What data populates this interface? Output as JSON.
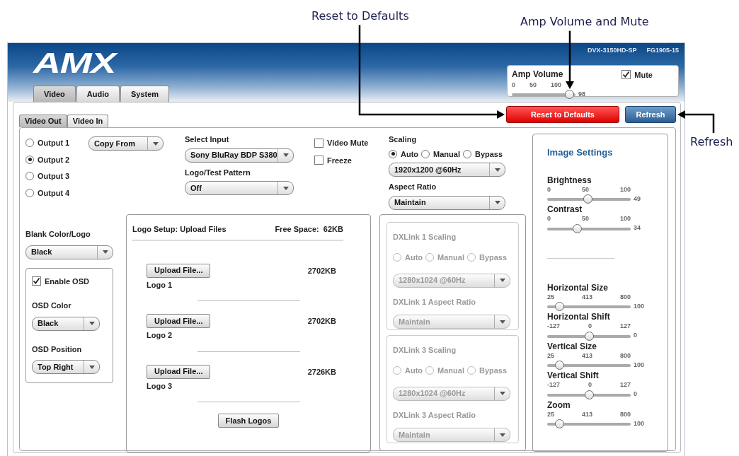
{
  "header": {
    "logo": "AMX",
    "model": "DVX-3150HD-SP",
    "serial": "FG1905-15"
  },
  "main_tabs": [
    {
      "label": "Video",
      "selected": true
    },
    {
      "label": "Audio",
      "selected": false
    },
    {
      "label": "System",
      "selected": false
    }
  ],
  "amp": {
    "title": "Amp Volume",
    "ticks": [
      "0",
      "50",
      "100"
    ],
    "level": 0.98,
    "reading": "98",
    "mute": {
      "label": "Mute",
      "checked": true
    },
    "callout": "Amp Volume and Mute"
  },
  "sub_tabs": [
    {
      "label": "Video Out",
      "selected": true
    },
    {
      "label": "Video In",
      "selected": false
    }
  ],
  "actions": [
    {
      "label": "Reset to Defaults",
      "kind": "danger",
      "callout": "Reset to Defaults"
    },
    {
      "label": "Refresh",
      "kind": "primary",
      "callout": "Refresh"
    }
  ],
  "outputs": [
    {
      "label": "Output 1",
      "selected": false
    },
    {
      "label": "Output 2",
      "selected": true
    },
    {
      "label": "Output 3",
      "selected": false
    },
    {
      "label": "Output 4",
      "selected": false
    }
  ],
  "copy_from": {
    "value": "Copy From"
  },
  "select_input": {
    "label": "Select Input",
    "value": "Sony BluRay BDP S380"
  },
  "logo_pattern": {
    "label": "Logo/Test Pattern",
    "value": "Off"
  },
  "toggles": [
    {
      "label": "Video Mute",
      "checked": false
    },
    {
      "label": "Freeze",
      "checked": false
    }
  ],
  "scaling": {
    "label": "Scaling",
    "modes": [
      {
        "label": "Auto",
        "selected": true
      },
      {
        "label": "Manual",
        "selected": false
      },
      {
        "label": "Bypass",
        "selected": false
      }
    ],
    "resolution": "1920x1200 @60Hz",
    "aspect_label": "Aspect Ratio",
    "aspect": "Maintain"
  },
  "dxlink": [
    {
      "title": "DXLink 1 Scaling",
      "disabled": true,
      "modes": [
        {
          "label": "Auto",
          "selected": false
        },
        {
          "label": "Manual",
          "selected": false
        },
        {
          "label": "Bypass",
          "selected": false
        }
      ],
      "resolution": "1280x1024 @60Hz",
      "aspect_label": "DXLink 1 Aspect Ratio",
      "aspect": "Maintain"
    },
    {
      "title": "DXLink 3 Scaling",
      "disabled": true,
      "modes": [
        {
          "label": "Auto",
          "selected": false
        },
        {
          "label": "Manual",
          "selected": false
        },
        {
          "label": "Bypass",
          "selected": false
        }
      ],
      "resolution": "1280x1024 @60Hz",
      "aspect_label": "DXLink 3 Aspect Ratio",
      "aspect": "Maintain"
    }
  ],
  "blank": {
    "label": "Blank Color/Logo",
    "value": "Black"
  },
  "osd": {
    "enable": {
      "label": "Enable OSD",
      "checked": true
    },
    "color_label": "OSD Color",
    "color_choice": "Black",
    "position_label": "OSD Position",
    "position": "Top Right"
  },
  "logo_setup": {
    "title": "Logo Setup: Upload Files",
    "free_space": "Free Space:  62KB",
    "logos": [
      {
        "button": "Upload File...",
        "name": "Logo 1",
        "size": "2702KB"
      },
      {
        "button": "Upload File...",
        "name": "Logo 2",
        "size": "2702KB"
      },
      {
        "button": "Upload File...",
        "name": "Logo 3",
        "size": "2726KB"
      }
    ],
    "flash": "Flash Logos"
  },
  "image_settings": {
    "title": "Image Settings",
    "sliders": [
      {
        "label": "Brightness",
        "ticks": [
          "0",
          "50",
          "100"
        ],
        "level": 0.49,
        "reading": "49"
      },
      {
        "label": "Contrast",
        "ticks": [
          "0",
          "50",
          "100"
        ],
        "level": 0.34,
        "reading": "34"
      },
      {
        "label": "Horizontal Size",
        "ticks": [
          "25",
          "413",
          "800"
        ],
        "level": 0.1,
        "reading": "100",
        "divider_before": true
      },
      {
        "label": "Horizontal Shift",
        "ticks": [
          "-127",
          "0",
          "127"
        ],
        "level": 0.5,
        "reading": "0"
      },
      {
        "label": "Vertical Size",
        "ticks": [
          "25",
          "413",
          "800"
        ],
        "level": 0.1,
        "reading": "100"
      },
      {
        "label": "Vertical Shift",
        "ticks": [
          "-127",
          "0",
          "127"
        ],
        "level": 0.5,
        "reading": "0"
      },
      {
        "label": "Zoom",
        "ticks": [
          "25",
          "413",
          "800"
        ],
        "level": 0.1,
        "reading": "100"
      }
    ]
  }
}
